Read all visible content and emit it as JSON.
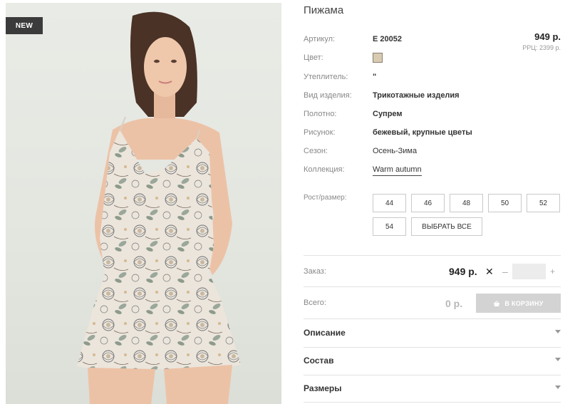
{
  "badge": "NEW",
  "product": {
    "title": "Пижама",
    "price": "949 р.",
    "rrp": "РРЦ: 2399 р."
  },
  "attributes": [
    {
      "label": "Артикул:",
      "value": "Е 20052"
    },
    {
      "label": "Цвет:",
      "value": ""
    },
    {
      "label": "Утеплитель:",
      "value": "\""
    },
    {
      "label": "Вид изделия:",
      "value": "Трикотажные изделия"
    },
    {
      "label": "Полотно:",
      "value": "Супрем"
    },
    {
      "label": "Рисунок:",
      "value": "бежевый, крупные цветы"
    },
    {
      "label": "Сезон:",
      "value": "Осень-Зима"
    },
    {
      "label": "Коллекция:",
      "value": "Warm autumn"
    }
  ],
  "color_swatch": "#d8cbb1",
  "sizes": {
    "label": "Рост/размер:",
    "options": [
      "44",
      "46",
      "48",
      "50",
      "52",
      "54"
    ],
    "select_all": "ВЫБРАТЬ ВСЕ"
  },
  "order": {
    "label": "Заказ:",
    "price": "949 р.",
    "times": "✕",
    "minus": "–",
    "plus": "+",
    "quantity": ""
  },
  "total": {
    "label": "Всего:",
    "value": "0 р.",
    "cart_button": "В КОРЗИНУ"
  },
  "accordion": [
    "Описание",
    "Состав",
    "Размеры"
  ]
}
